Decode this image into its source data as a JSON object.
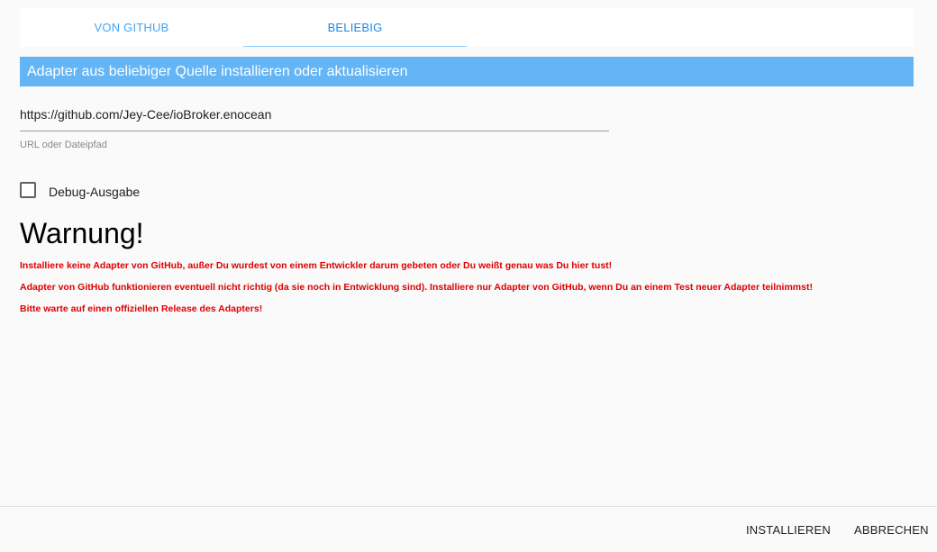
{
  "tabs": {
    "github": "VON GITHUB",
    "any": "BELIEBIG"
  },
  "header": {
    "title": "Adapter aus beliebiger Quelle installieren oder aktualisieren"
  },
  "url_field": {
    "value": "https://github.com/Jey-Cee/ioBroker.enocean",
    "helper": "URL oder Dateipfad"
  },
  "debug": {
    "label": "Debug-Ausgabe",
    "checked": false
  },
  "warning": {
    "title": "Warnung!",
    "lines": [
      "Installiere keine Adapter von GitHub, außer Du wurdest von einem Entwickler darum gebeten oder Du weißt genau was Du hier tust!",
      "Adapter von GitHub funktionieren eventuell nicht richtig (da sie noch in Entwicklung sind). Installiere nur Adapter von GitHub, wenn Du an einem Test neuer Adapter teilnimmst!",
      "Bitte warte auf einen offiziellen Release des Adapters!"
    ]
  },
  "footer": {
    "install": "INSTALLIEREN",
    "cancel": "ABBRECHEN"
  },
  "colors": {
    "accent": "#64b5f6",
    "tab_text": "#2196f3",
    "warning_text": "#e00000"
  }
}
